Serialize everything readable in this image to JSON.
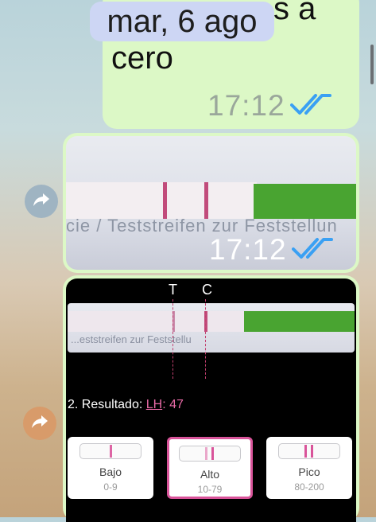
{
  "date_pill": "mar, 6 ago",
  "message_text": {
    "tail_text": "s a",
    "body_text": "cero",
    "time": "17:12"
  },
  "photo_message": {
    "print_text": "cie / Teststreifen zur Feststellun",
    "time": "17:12"
  },
  "app_screenshot": {
    "t_label": "T",
    "c_label": "C",
    "result_prefix": "2. Resultado: ",
    "result_hormone": "LH",
    "result_sep": ": ",
    "result_value": "47",
    "strip_print_text": "...eststreifen zur Feststellu",
    "cards": [
      {
        "name": "Bajo",
        "range": "0-9"
      },
      {
        "name": "Alto",
        "range": "10-79"
      },
      {
        "name": "Pico",
        "range": "80-200"
      }
    ]
  },
  "colors": {
    "bubble": "#dcf8c6",
    "date_pill": "#cdd6f4",
    "read_ticks": "#3aa0f3",
    "test_line": "#c14b7b",
    "accent_pink": "#d9549a",
    "share_gray": "#9fb4c2",
    "share_orange": "#d89b6a"
  },
  "icons": [
    "double-check-icon",
    "share-icon",
    "share-icon"
  ]
}
